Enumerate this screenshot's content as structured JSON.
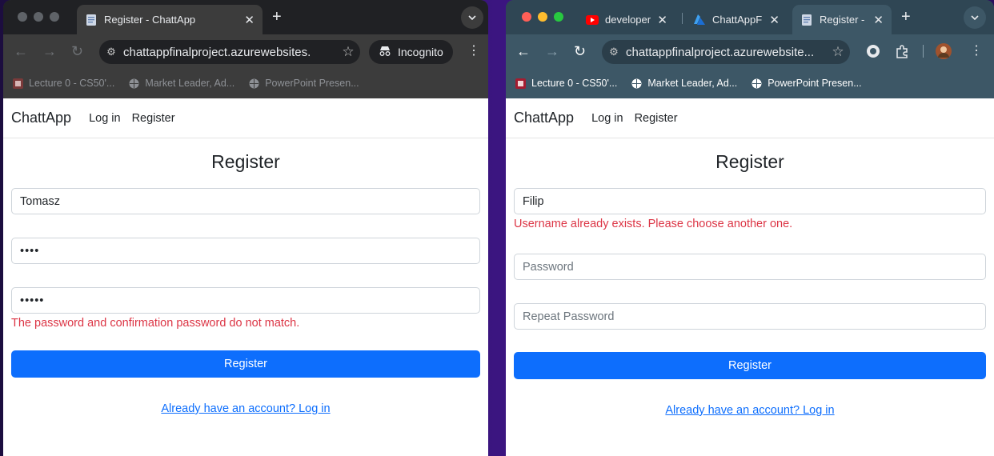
{
  "left": {
    "tabs": [
      {
        "title": "Register - ChattApp"
      }
    ],
    "newtab": "+",
    "url": "chattappfinalproject.azurewebsites.",
    "incognito_label": "Incognito",
    "bookmarks": [
      {
        "label": "Lecture 0 - CS50'...",
        "icon": "harvard-icon"
      },
      {
        "label": "Market Leader, Ad...",
        "icon": "globe-icon"
      },
      {
        "label": "PowerPoint Presen...",
        "icon": "globe-icon"
      }
    ],
    "nav": {
      "brand": "ChattApp",
      "login": "Log in",
      "register": "Register"
    },
    "form": {
      "title": "Register",
      "username_value": "Tomasz",
      "password_value": "••••",
      "repeat_value": "•••••",
      "password_error": "The password and confirmation password do not match.",
      "submit": "Register",
      "login_link": "Already have an account? Log in"
    }
  },
  "right": {
    "tabs": [
      {
        "title": "developerli",
        "icon": "youtube-icon"
      },
      {
        "title": "ChattAppF",
        "icon": "azure-icon"
      },
      {
        "title": "Register - C",
        "icon": "document-icon"
      }
    ],
    "newtab": "+",
    "url": "chattappfinalproject.azurewebsite...",
    "bookmarks": [
      {
        "label": "Lecture 0 - CS50'...",
        "icon": "harvard-icon"
      },
      {
        "label": "Market Leader, Ad...",
        "icon": "globe-icon"
      },
      {
        "label": "PowerPoint Presen...",
        "icon": "globe-icon"
      }
    ],
    "nav": {
      "brand": "ChattApp",
      "login": "Log in",
      "register": "Register"
    },
    "form": {
      "title": "Register",
      "username_value": "Filip",
      "username_error": "Username already exists. Please choose another one.",
      "password_placeholder": "Password",
      "repeat_placeholder": "Repeat Password",
      "submit": "Register",
      "login_link": "Already have an account? Log in"
    }
  },
  "colors": {
    "accent": "#0d6efd",
    "error": "#dc3545"
  }
}
